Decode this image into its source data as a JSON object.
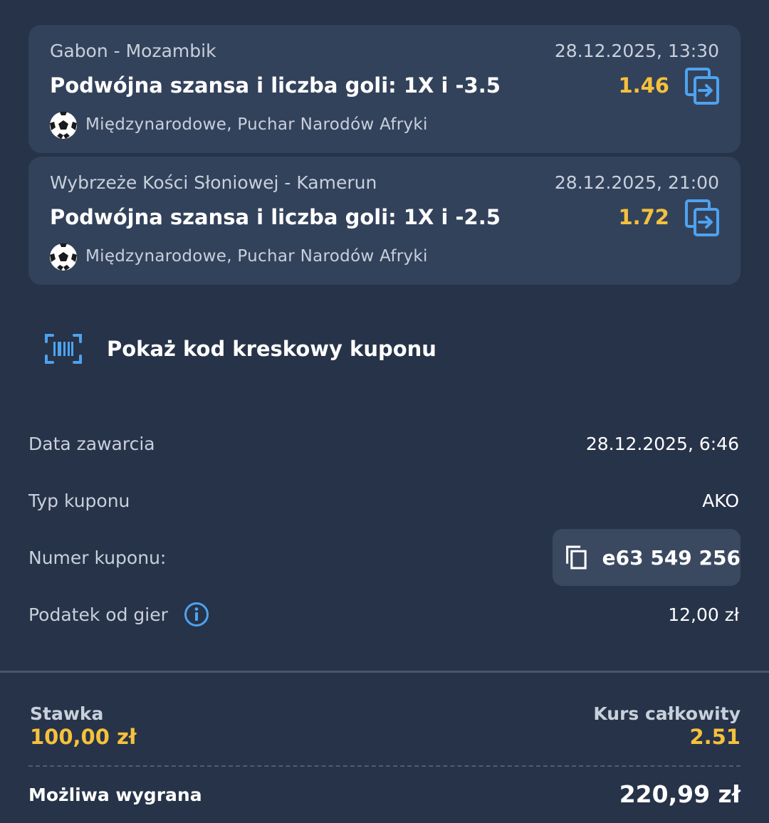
{
  "bets": [
    {
      "match": "Gabon - Mozambik",
      "datetime": "28.12.2025, 13:30",
      "selection": "Podwójna szansa i liczba goli: 1X i -3.5",
      "odds": "1.46",
      "league": "Międzynarodowe, Puchar Narodów Afryki"
    },
    {
      "match": "Wybrzeże Kości Słoniowej - Kamerun",
      "datetime": "28.12.2025, 21:00",
      "selection": "Podwójna szansa i liczba goli: 1X i -2.5",
      "odds": "1.72",
      "league": "Międzynarodowe, Puchar Narodów Afryki"
    }
  ],
  "barcode": {
    "label": "Pokaż kod kreskowy kuponu"
  },
  "details": {
    "date_label": "Data zawarcia",
    "date_value": "28.12.2025, 6:46",
    "type_label": "Typ kuponu",
    "type_value": "AKO",
    "number_label": "Numer kuponu:",
    "number_value": "e63 549 256",
    "tax_label": "Podatek od gier",
    "tax_value": "12,00 zł"
  },
  "summary": {
    "stake_label": "Stawka",
    "stake_value": "100,00 zł",
    "total_odds_label": "Kurs całkowity",
    "total_odds_value": "2.51",
    "win_label": "Możliwa wygrana",
    "win_value": "220,99 zł"
  },
  "colors": {
    "background": "#273348",
    "card": "#33425b",
    "accent_yellow": "#f5c13c",
    "accent_blue": "#4da3f0"
  }
}
